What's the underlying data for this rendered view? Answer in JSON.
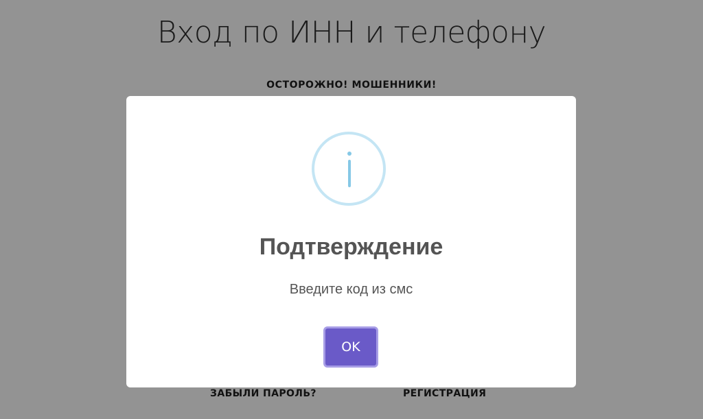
{
  "page": {
    "title": "Вход по ИНН и телефону",
    "warning_link": "ОСТОРОЖНО! МОШЕННИКИ!",
    "forgot_password_link": "ЗАБЫЛИ ПАРОЛЬ?",
    "register_link": "РЕГИСТРАЦИЯ"
  },
  "modal": {
    "icon": "info-icon",
    "title": "Подтверждение",
    "text": "Введите код из смс",
    "ok_label": "OK"
  },
  "colors": {
    "overlay": "#939393",
    "modal_background": "#ffffff",
    "icon_ring": "#c4e5f4",
    "icon_glyph": "#86c8e6",
    "button_background": "#6a5ac8",
    "button_border": "#a79de6",
    "text": "#545454"
  }
}
